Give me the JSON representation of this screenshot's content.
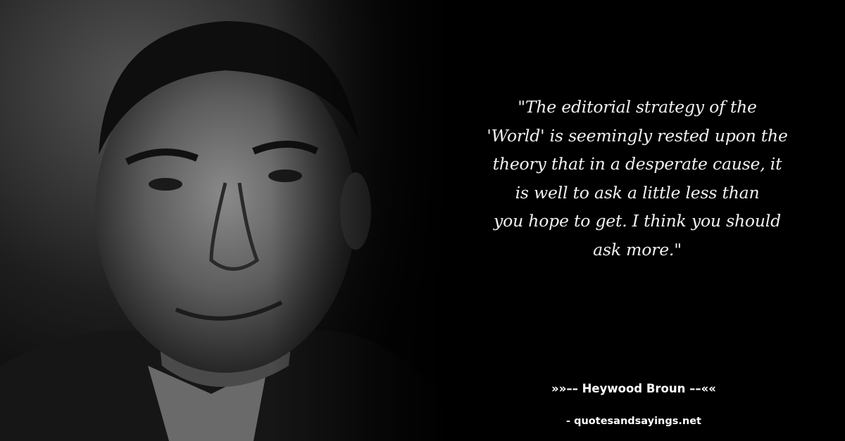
{
  "quote": {
    "lines": [
      "\"The editorial strategy of the",
      "'World' is seemingly rested upon the",
      "theory that in a desperate cause, it",
      "is well to ask a little less than",
      "you hope to get. I think you should",
      "ask more.\""
    ]
  },
  "author": {
    "text": "»»–– Heywood Broun ––««"
  },
  "source": {
    "text": "- quotesandsayings.net"
  }
}
